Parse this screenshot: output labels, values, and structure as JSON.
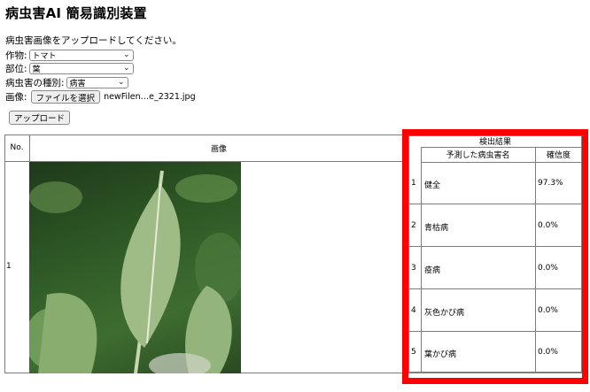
{
  "page": {
    "title": "病虫害AI 簡易識別装置",
    "intro": "病虫害画像をアップロードしてください。"
  },
  "form": {
    "crop": {
      "label": "作物:",
      "value": "トマト"
    },
    "part": {
      "label": "部位:",
      "value": "葉"
    },
    "type": {
      "label": "病虫害の種別:",
      "value": "病害"
    },
    "image": {
      "label": "画像:",
      "button": "ファイルを選択",
      "filename": "newFilen…e_2321.jpg"
    },
    "upload_button": "アップロード"
  },
  "table": {
    "headers": {
      "no": "No.",
      "image": "画像",
      "result": "検出結果",
      "predicted": "予測した病虫害名",
      "confidence": "確信度"
    },
    "row_no": "1",
    "results": [
      {
        "rank": "1",
        "name": "健全",
        "confidence": "97.3%"
      },
      {
        "rank": "2",
        "name": "青枯病",
        "confidence": "0.0%"
      },
      {
        "rank": "3",
        "name": "疫病",
        "confidence": "0.0%"
      },
      {
        "rank": "4",
        "name": "灰色かび病",
        "confidence": "0.0%"
      },
      {
        "rank": "5",
        "name": "葉かび病",
        "confidence": "0.0%"
      }
    ]
  },
  "colors": {
    "highlight": "#ff0000",
    "border": "#7d7d7d"
  }
}
